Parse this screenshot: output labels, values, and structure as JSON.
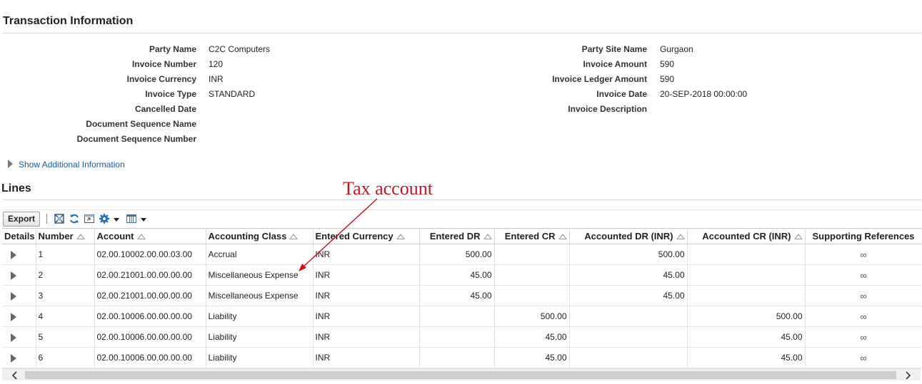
{
  "transaction": {
    "title": "Transaction Information",
    "left_fields": [
      {
        "label": "Party Name",
        "value": "C2C Computers"
      },
      {
        "label": "Invoice Number",
        "value": "120"
      },
      {
        "label": "Invoice Currency",
        "value": "INR"
      },
      {
        "label": "Invoice Type",
        "value": "STANDARD"
      },
      {
        "label": "Cancelled Date",
        "value": ""
      },
      {
        "label": "Document Sequence Name",
        "value": ""
      },
      {
        "label": "Document Sequence Number",
        "value": ""
      }
    ],
    "right_fields": [
      {
        "label": "Party Site Name",
        "value": "Gurgaon"
      },
      {
        "label": "Invoice Amount",
        "value": "590"
      },
      {
        "label": "Invoice Ledger Amount",
        "value": "590"
      },
      {
        "label": "Invoice Date",
        "value": "20-SEP-2018 00:00:00"
      },
      {
        "label": "Invoice Description",
        "value": ""
      }
    ],
    "show_additional": "Show Additional Information"
  },
  "lines": {
    "title": "Lines",
    "toolbar": {
      "export_label": "Export",
      "icons": [
        "detach-icon",
        "refresh-icon",
        "freeze-icon",
        "settings-icon",
        "columns-icon"
      ]
    },
    "columns": [
      "Details",
      "Number",
      "Account",
      "Accounting Class",
      "Entered Currency",
      "Entered DR",
      "Entered CR",
      "Accounted DR (INR)",
      "Accounted CR (INR)",
      "Supporting References"
    ],
    "rows": [
      {
        "number": "1",
        "account": "02.00.10002.00.00.03.00",
        "class": "Accrual",
        "currency": "INR",
        "entered_dr": "500.00",
        "entered_cr": "",
        "accounted_dr": "500.00",
        "accounted_cr": "",
        "supporting": "∞"
      },
      {
        "number": "2",
        "account": "02.00.21001.00.00.00.00",
        "class": "Miscellaneous Expense",
        "currency": "INR",
        "entered_dr": "45.00",
        "entered_cr": "",
        "accounted_dr": "45.00",
        "accounted_cr": "",
        "supporting": "∞"
      },
      {
        "number": "3",
        "account": "02.00.21001.00.00.00.00",
        "class": "Miscellaneous Expense",
        "currency": "INR",
        "entered_dr": "45.00",
        "entered_cr": "",
        "accounted_dr": "45.00",
        "accounted_cr": "",
        "supporting": "∞"
      },
      {
        "number": "4",
        "account": "02.00.10006.00.00.00.00",
        "class": "Liability",
        "currency": "INR",
        "entered_dr": "",
        "entered_cr": "500.00",
        "accounted_dr": "",
        "accounted_cr": "500.00",
        "supporting": "∞"
      },
      {
        "number": "5",
        "account": "02.00.10006.00.00.00.00",
        "class": "Liability",
        "currency": "INR",
        "entered_dr": "",
        "entered_cr": "45.00",
        "accounted_dr": "",
        "accounted_cr": "45.00",
        "supporting": "∞"
      },
      {
        "number": "6",
        "account": "02.00.10006.00.00.00.00",
        "class": "Liability",
        "currency": "INR",
        "entered_dr": "",
        "entered_cr": "45.00",
        "accounted_dr": "",
        "accounted_cr": "45.00",
        "supporting": "∞"
      }
    ]
  },
  "annotation": {
    "text": "Tax account",
    "color": "#c3171c"
  }
}
